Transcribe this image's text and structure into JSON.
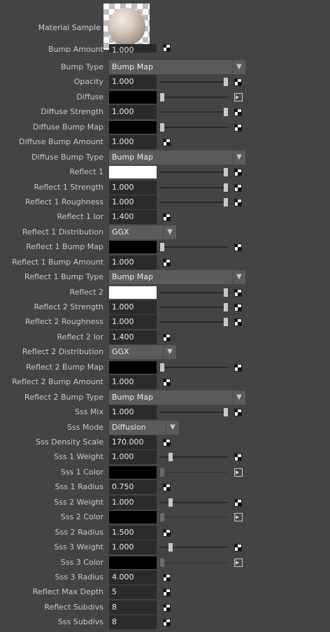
{
  "header": {
    "label": "Material Sample",
    "top_cut_label": "Bump Amount",
    "top_cut_value": "1.000"
  },
  "rows": [
    {
      "label": "Bump Type",
      "kind": "combo",
      "value": "Bump Map",
      "width": "wide"
    },
    {
      "label": "Opacity",
      "kind": "num",
      "value": "1.000",
      "slider": 1.0,
      "port": "checker"
    },
    {
      "label": "Diffuse",
      "kind": "color",
      "color": "#000000",
      "slider": 0.0,
      "port": "output"
    },
    {
      "label": "Diffuse Strength",
      "kind": "num",
      "value": "1.000",
      "slider": 1.0,
      "port": "checker"
    },
    {
      "label": "Diffuse Bump Map",
      "kind": "color",
      "color": "#000000",
      "slider": 0.0,
      "port": "checker"
    },
    {
      "label": "Diffuse Bump Amount",
      "kind": "num",
      "value": "1.000",
      "port": "checker-near"
    },
    {
      "label": "Diffuse Bump Type",
      "kind": "combo",
      "value": "Bump Map",
      "width": "wide"
    },
    {
      "label": "Reflect 1",
      "kind": "color",
      "color": "#ffffff",
      "slider": 1.0,
      "port": "checker"
    },
    {
      "label": "Reflect 1 Strength",
      "kind": "num",
      "value": "1.000",
      "slider": 1.0,
      "port": "checker"
    },
    {
      "label": "Reflect 1 Roughness",
      "kind": "num",
      "value": "1.000",
      "slider": 1.0,
      "port": "checker"
    },
    {
      "label": "Reflect 1 Ior",
      "kind": "num",
      "value": "1.400",
      "port": "checker-near"
    },
    {
      "label": "Reflect 1 Distribution",
      "kind": "combo",
      "value": "GGX",
      "width": "small"
    },
    {
      "label": "Reflect 1 Bump Map",
      "kind": "color",
      "color": "#000000",
      "slider": 0.0,
      "port": "checker"
    },
    {
      "label": "Reflect 1 Bump Amount",
      "kind": "num",
      "value": "1.000",
      "port": "checker-near"
    },
    {
      "label": "Reflect 1 Bump Type",
      "kind": "combo",
      "value": "Bump Map",
      "width": "wide"
    },
    {
      "label": "Reflect 2",
      "kind": "color",
      "color": "#ffffff",
      "slider": 1.0,
      "port": "checker"
    },
    {
      "label": "Reflect 2 Strength",
      "kind": "num",
      "value": "1.000",
      "slider": 1.0,
      "port": "checker"
    },
    {
      "label": "Reflect 2 Roughness",
      "kind": "num",
      "value": "1.000",
      "slider": 1.0,
      "port": "checker"
    },
    {
      "label": "Reflect 2 Ior",
      "kind": "num",
      "value": "1.400",
      "port": "checker-near"
    },
    {
      "label": "Reflect 2 Distribution",
      "kind": "combo",
      "value": "GGX",
      "width": "small"
    },
    {
      "label": "Reflect 2 Bump Map",
      "kind": "color",
      "color": "#000000",
      "slider": 0.0,
      "port": "checker"
    },
    {
      "label": "Reflect 2 Bump Amount",
      "kind": "num",
      "value": "1.000",
      "port": "checker-near"
    },
    {
      "label": "Reflect 2 Bump Type",
      "kind": "combo",
      "value": "Bump Map",
      "width": "wide"
    },
    {
      "label": "Sss Mix",
      "kind": "num",
      "value": "1.000",
      "slider": 1.0,
      "port": "checker"
    },
    {
      "label": "Sss Mode",
      "kind": "combo",
      "value": "Diffusion",
      "width": "medium"
    },
    {
      "label": "Sss Density Scale",
      "kind": "num",
      "value": "170.000",
      "port": "checker-near"
    },
    {
      "label": "Sss 1 Weight",
      "kind": "num",
      "value": "1.000",
      "slider": 0.13,
      "port": "checker"
    },
    {
      "label": "Sss 1 Color",
      "kind": "color",
      "color": "#000000",
      "slider": 0.0,
      "slider_dim": true,
      "port": "output"
    },
    {
      "label": "Sss 1 Radius",
      "kind": "num",
      "value": "0.750",
      "port": "checker-near"
    },
    {
      "label": "Sss 2 Weight",
      "kind": "num",
      "value": "1.000",
      "slider": 0.13,
      "port": "checker"
    },
    {
      "label": "Sss 2 Color",
      "kind": "color",
      "color": "#000000",
      "slider": 0.0,
      "slider_dim": true,
      "port": "output"
    },
    {
      "label": "Sss 2 Radius",
      "kind": "num",
      "value": "1.500",
      "port": "checker-near"
    },
    {
      "label": "Sss 3 Weight",
      "kind": "num",
      "value": "1.000",
      "slider": 0.13,
      "port": "checker"
    },
    {
      "label": "Sss 3 Color",
      "kind": "color",
      "color": "#000000",
      "slider": 0.0,
      "slider_dim": true,
      "port": "output"
    },
    {
      "label": "Sss 3 Radius",
      "kind": "num",
      "value": "4.000",
      "port": "checker-near"
    },
    {
      "label": "Reflect Max Depth",
      "kind": "num",
      "value": "5",
      "port": "checker-near"
    },
    {
      "label": "Reflect Subdivs",
      "kind": "num",
      "value": "8",
      "port": "checker-near"
    },
    {
      "label": "Sss Subdivs",
      "kind": "num",
      "value": "8",
      "port": "checker-near"
    }
  ]
}
